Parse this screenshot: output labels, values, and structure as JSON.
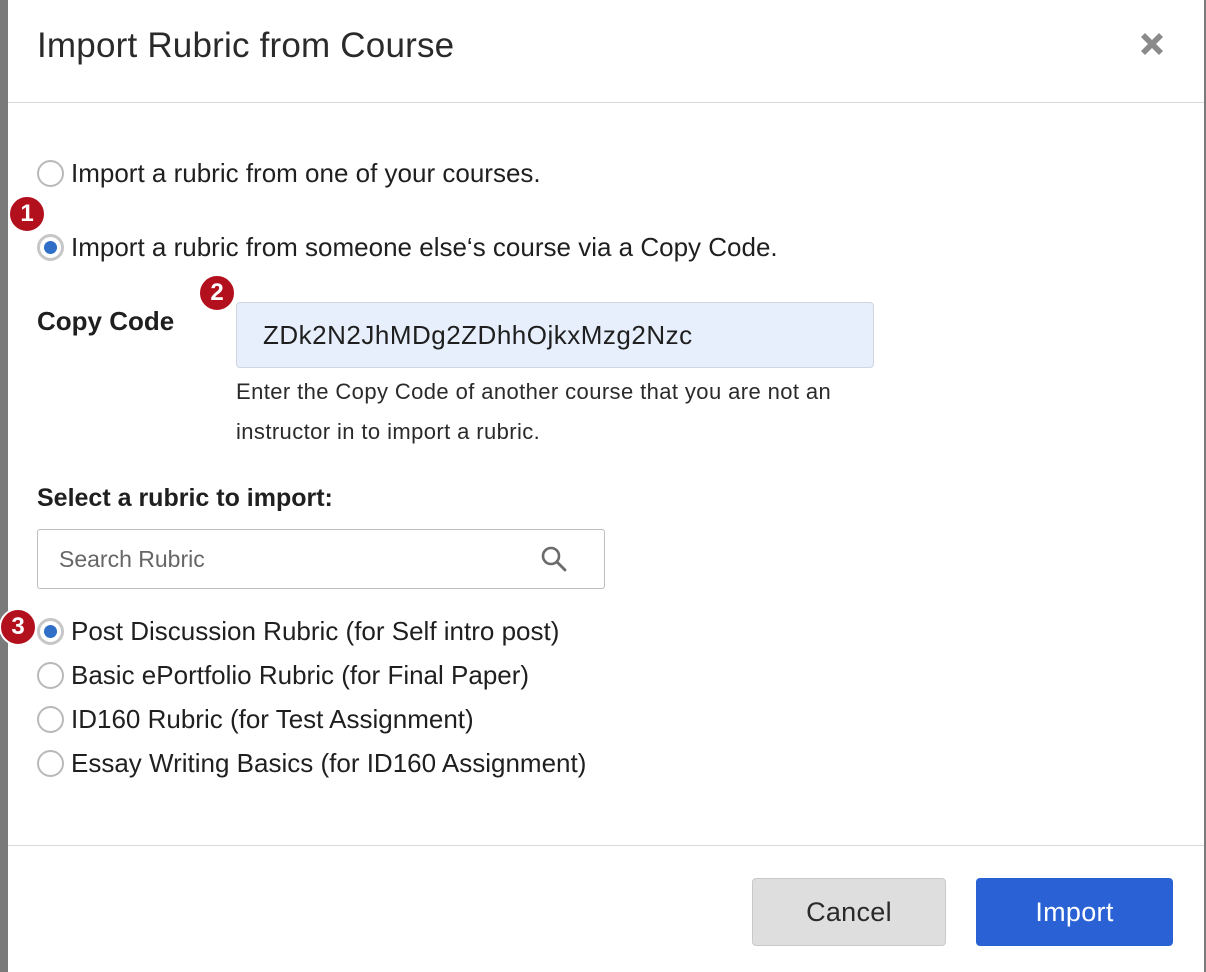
{
  "dialog": {
    "title": "Import Rubric from Course",
    "close_icon": "close-icon"
  },
  "import_options": [
    {
      "label": "Import a rubric from one of your courses.",
      "selected": false
    },
    {
      "label": "Import a rubric from someone else‘s course via a Copy Code.",
      "selected": true
    }
  ],
  "copy_code": {
    "label": "Copy Code",
    "value": "ZDk2N2JhMDg2ZDhhOjkxMzg2Nzc",
    "help": "Enter the Copy Code of another course that you are not an instructor in to import a rubric."
  },
  "rubric_select": {
    "label": "Select a rubric to import:",
    "search_placeholder": "Search Rubric",
    "search_icon": "search-icon",
    "rubrics": [
      {
        "label": "Post Discussion Rubric (for Self intro post)",
        "selected": true
      },
      {
        "label": "Basic ePortfolio Rubric (for Final Paper)",
        "selected": false
      },
      {
        "label": "ID160 Rubric (for Test Assignment)",
        "selected": false
      },
      {
        "label": "Essay Writing Basics (for ID160 Assignment)",
        "selected": false
      }
    ]
  },
  "footer": {
    "cancel_label": "Cancel",
    "import_label": "Import"
  },
  "annotations": [
    "1",
    "2",
    "3"
  ],
  "colors": {
    "primary": "#2a62d6",
    "radio_selected": "#2f6fc8",
    "badge": "#b3101e",
    "input_fill": "#e7effd"
  }
}
